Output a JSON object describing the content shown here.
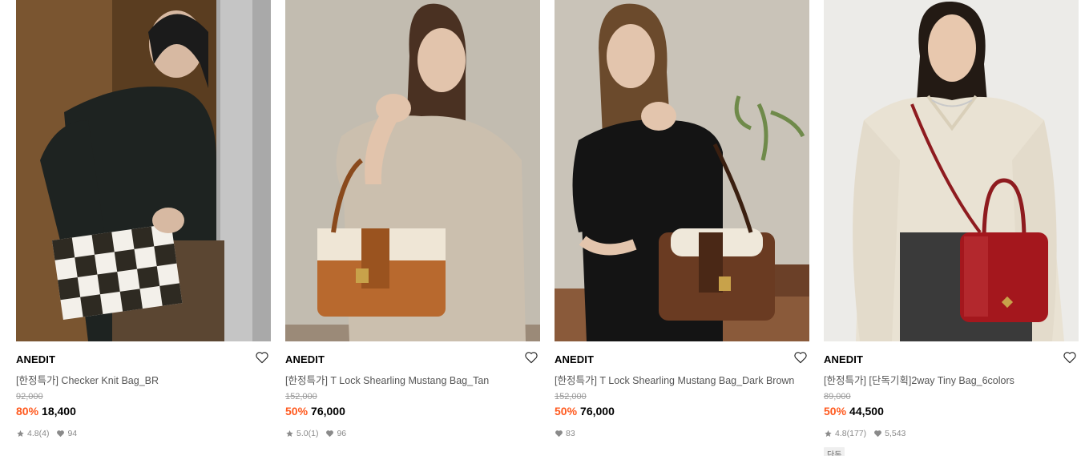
{
  "products": [
    {
      "brand": "ANEDIT",
      "name": "[한정특가] Checker Knit Bag_BR",
      "original_price": "92,000",
      "discount": "80%",
      "price": "18,400",
      "rating": "4.8",
      "reviews": "(4)",
      "likes": "94",
      "image": "woman-dark-blouse-checker-knit-bag"
    },
    {
      "brand": "ANEDIT",
      "name": "[한정특가] T Lock Shearling Mustang Bag_Tan",
      "original_price": "152,000",
      "discount": "50%",
      "price": "76,000",
      "rating": "5.0",
      "reviews": "(1)",
      "likes": "96",
      "image": "woman-beige-top-tan-shearling-bag"
    },
    {
      "brand": "ANEDIT",
      "name": "[한정특가] T Lock Shearling Mustang Bag_Dark Brown",
      "original_price": "152,000",
      "discount": "50%",
      "price": "76,000",
      "likes": "83",
      "image": "woman-black-top-brown-shearling-bag"
    },
    {
      "brand": "ANEDIT",
      "name": "[한정특가] [단독기획]2way Tiny Bag_6colors",
      "original_price": "89,000",
      "discount": "50%",
      "price": "44,500",
      "rating": "4.8",
      "reviews": "(177)",
      "likes": "5,543",
      "tag": "단독",
      "image": "woman-cream-sweater-red-tiny-bag"
    }
  ],
  "icons": {
    "wishlist": "heart-outline-icon",
    "rating": "star-icon",
    "likes": "heart-filled-icon"
  },
  "colors": {
    "discount": "#ff5a1f",
    "muted": "#8a8a8a"
  }
}
